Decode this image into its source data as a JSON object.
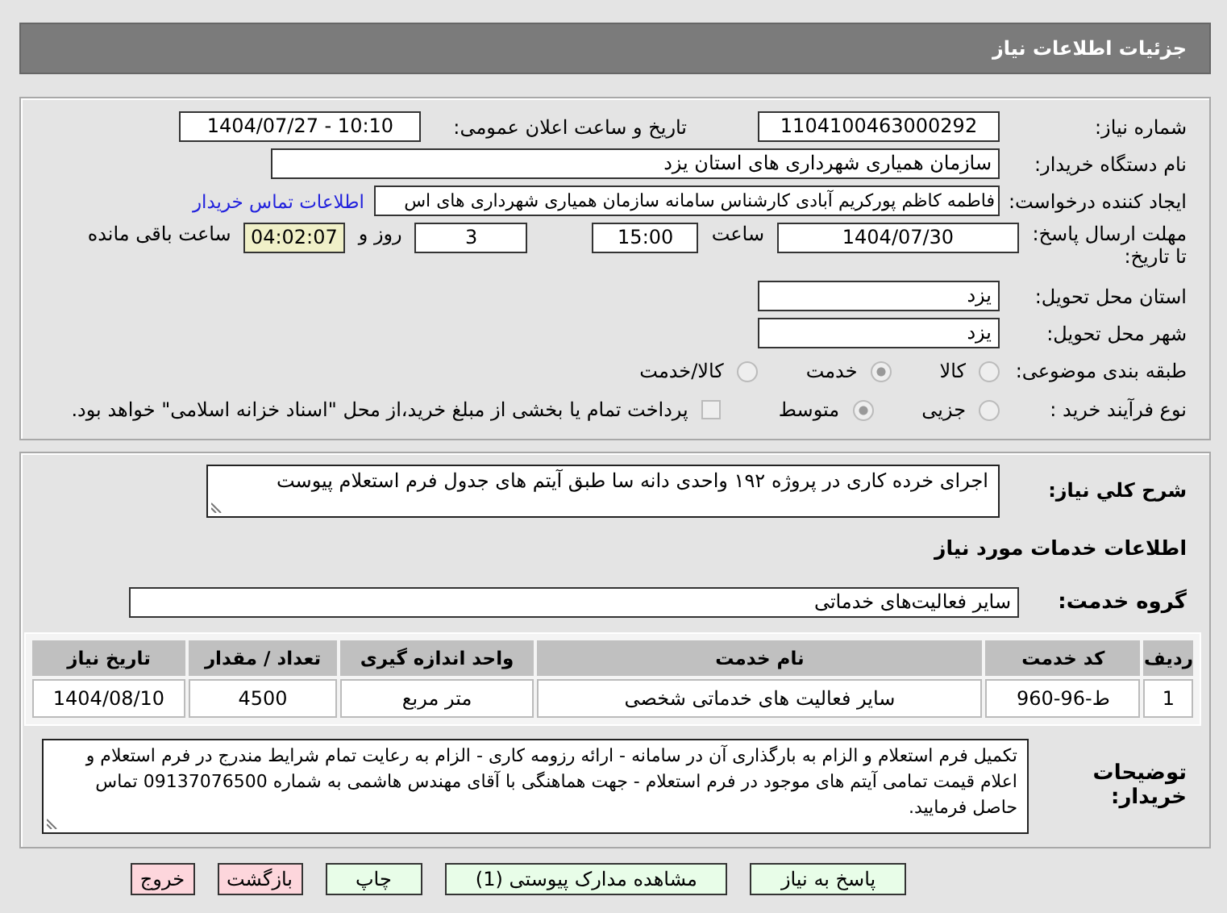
{
  "window": {
    "title": "جزئیات اطلاعات نیاز"
  },
  "need_number": {
    "label": "شماره نیاز:",
    "value": "1104100463000292"
  },
  "announce": {
    "label": "تاریخ و ساعت اعلان عمومی:",
    "value": "1404/07/27 - 10:10"
  },
  "buyer_org": {
    "label": "نام دستگاه خریدار:",
    "value": "سازمان همیاری شهرداری های استان یزد"
  },
  "requester": {
    "label": "ایجاد کننده درخواست:",
    "value": "فاطمه کاظم پورکریم آبادی کارشناس سامانه سازمان همیاری شهرداری های اس",
    "link": "اطلاعات تماس خریدار"
  },
  "deadline": {
    "label": "مهلت ارسال پاسخ: تا تاریخ:",
    "date": "1404/07/30",
    "time_label": "ساعت",
    "time": "15:00",
    "days": "3",
    "days_label": "روز و",
    "remaining": "04:02:07",
    "remaining_label": "ساعت باقی مانده"
  },
  "province": {
    "label": "استان محل تحویل:",
    "value": "یزد"
  },
  "city": {
    "label": "شهر محل تحویل:",
    "value": "یزد"
  },
  "category": {
    "label": "طبقه بندی موضوعی:",
    "options": [
      {
        "label": "کالا",
        "selected": false
      },
      {
        "label": "خدمت",
        "selected": true
      },
      {
        "label": "کالا/خدمت",
        "selected": false
      }
    ]
  },
  "process": {
    "label": "نوع فرآیند خرید :",
    "options": [
      {
        "label": "جزیی",
        "selected": false
      },
      {
        "label": "متوسط",
        "selected": true
      }
    ],
    "payment": {
      "checked": false,
      "text": "پرداخت تمام یا بخشی از مبلغ خرید،از محل \"اسناد خزانه اسلامی\" خواهد بود."
    }
  },
  "description": {
    "label": "شرح کلي نياز:",
    "value": "اجرای خرده کاری در پروژه ۱۹۲ واحدی دانه سا طبق آیتم های جدول فرم استعلام پیوست"
  },
  "services_title": "اطلاعات خدمات مورد نیاز",
  "service_group": {
    "label": "گروه خدمت:",
    "value": "سایر فعالیت‌های خدماتی"
  },
  "table": {
    "columns": [
      "ردیف",
      "کد خدمت",
      "نام خدمت",
      "واحد اندازه گیری",
      "تعداد / مقدار",
      "تاریخ نیاز"
    ],
    "rows": [
      [
        "1",
        "ط-96-960",
        "سایر فعالیت های خدماتی شخصی",
        "متر مربع",
        "4500",
        "1404/08/10"
      ]
    ]
  },
  "buyer_notes": {
    "label": "توضیحات خریدار:",
    "value": "تکمیل فرم استعلام و الزام به بارگذاری آن در سامانه - ارائه رزومه کاری - الزام به رعایت تمام شرایط مندرج در فرم استعلام و اعلام قیمت تمامی آیتم های موجود در فرم استعلام - جهت هماهنگی با آقای مهندس هاشمی به شماره 09137076500 تماس حاصل فرمایید."
  },
  "buttons": [
    {
      "label": "پاسخ به نیاز",
      "kind": "primary"
    },
    {
      "label": "مشاهده مدارک پیوستی (1)",
      "kind": "primary"
    },
    {
      "label": "چاپ",
      "kind": "primary"
    },
    {
      "label": "بازگشت",
      "kind": "danger"
    },
    {
      "label": "خروج",
      "kind": "danger"
    }
  ]
}
